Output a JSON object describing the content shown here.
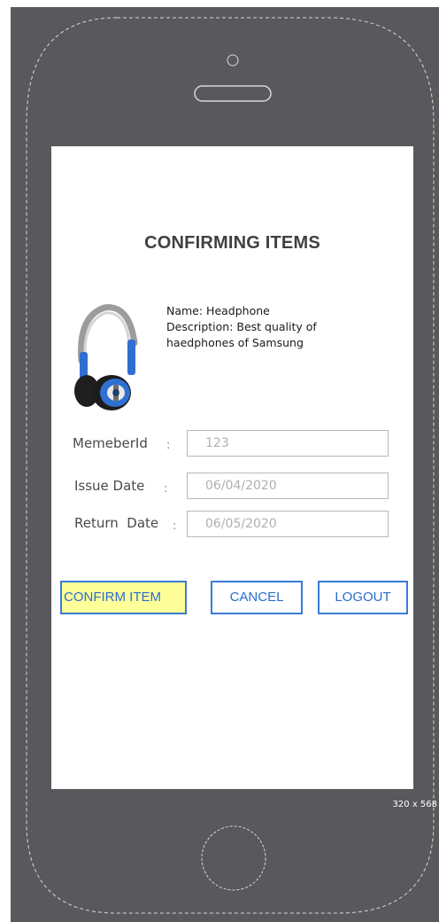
{
  "screen": {
    "title": "CONFIRMING ITEMS",
    "item": {
      "name_line": "Name: Headphone",
      "description_line1": "Description: Best quality of",
      "description_line2": "haedphones of Samsung",
      "image_icon": "headphone-icon"
    },
    "form": {
      "member_id": {
        "label": "MemeberId",
        "colon": ":",
        "value": "123"
      },
      "issue_date": {
        "label": "Issue Date",
        "colon": ":",
        "value": "06/04/2020"
      },
      "return_date": {
        "label": "Return  Date",
        "colon": ":",
        "value": "06/05/2020"
      }
    },
    "buttons": {
      "confirm": "CONFIRM ITEM",
      "cancel": "CANCEL",
      "logout": "LOGOUT"
    }
  },
  "device": {
    "size_label": "320 x 568"
  },
  "colors": {
    "phone_body": "#59585d",
    "button_border": "#3a7bd5",
    "confirm_highlight": "#ffff99"
  }
}
